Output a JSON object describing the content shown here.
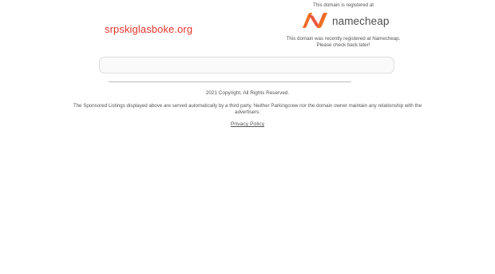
{
  "domain": {
    "name": "srpskiglasboke.org"
  },
  "registrar": {
    "registered_at_text": "This domain is registered at",
    "logo_text": "namecheap",
    "brand_colors": [
      "#f15a24",
      "#e8472b"
    ],
    "message_line1": "This domain was recently registered at Namecheap.",
    "message_line2": "Please check back later!"
  },
  "search": {
    "value": "",
    "placeholder": ""
  },
  "footer": {
    "copyright": "2021 Copyright. All Rights Reserved.",
    "sponsored_line1": "The Sponsored Listings displayed above are served automatically by a third party. Neither Parkingcrew nor the domain owner maintain any relationship with the",
    "sponsored_line2": "advertisers.",
    "privacy_link": "Privacy Policy"
  },
  "colors": {
    "domain_title": "#e5352c",
    "text": "#555555",
    "divider": "#bdbdbd"
  }
}
